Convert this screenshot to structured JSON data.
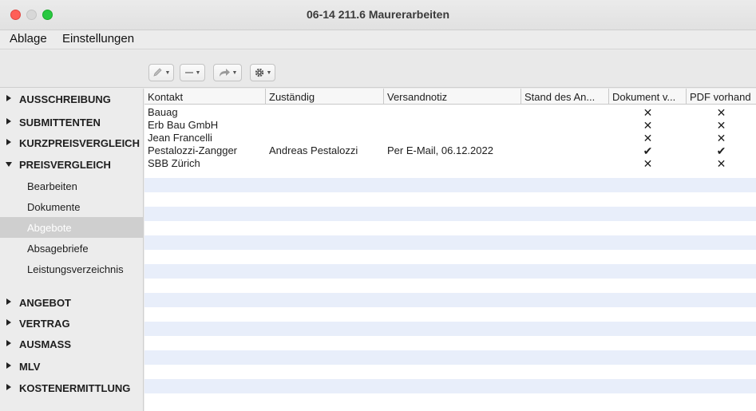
{
  "window": {
    "title": "06-14 211.6 Maurerarbeiten"
  },
  "menu": [
    "Ablage",
    "Einstellungen"
  ],
  "toolbar": {
    "buttons": [
      {
        "icon": "pencil-icon"
      },
      {
        "icon": "minus-icon"
      },
      {
        "icon": "share-arrow-icon"
      },
      {
        "icon": "gear-icon"
      }
    ]
  },
  "sidebar": {
    "sections": [
      {
        "label": "AUSSCHREIBUNG",
        "expanded": false
      },
      {
        "label": "SUBMITTENTEN",
        "expanded": false
      },
      {
        "label": "KURZPREISVERGLEICH",
        "expanded": false
      },
      {
        "label": "PREISVERGLEICH",
        "expanded": true,
        "items": [
          {
            "label": "Bearbeiten",
            "selected": false
          },
          {
            "label": "Dokumente",
            "selected": false
          },
          {
            "label": "Abgebote",
            "selected": true
          },
          {
            "label": "Absagebriefe",
            "selected": false
          },
          {
            "label": "Leistungsverzeichnis",
            "selected": false
          }
        ]
      },
      {
        "label": "ANGEBOT",
        "expanded": false
      },
      {
        "label": "VERTRAG",
        "expanded": false
      },
      {
        "label": "AUSMASS",
        "expanded": false
      },
      {
        "label": "MLV",
        "expanded": false
      },
      {
        "label": "KOSTENERMITTLUNG",
        "expanded": false
      }
    ]
  },
  "table": {
    "columns": [
      "Kontakt",
      "Zuständig",
      "Versandnotiz",
      "Stand des An...",
      "Dokument v...",
      "PDF vorhand"
    ],
    "rows": [
      [
        "Bauag",
        "",
        "",
        "",
        "✕",
        "✕"
      ],
      [
        "Erb Bau GmbH",
        "",
        "",
        "",
        "✕",
        "✕"
      ],
      [
        "Jean Francelli",
        "",
        "",
        "",
        "✕",
        "✕"
      ],
      [
        "Pestalozzi-Zangger",
        "Andreas Pestalozzi",
        "Per E-Mail, 06.12.2022",
        "",
        "✔",
        "✔"
      ],
      [
        "SBB Zürich",
        "",
        "",
        "",
        "✕",
        "✕"
      ]
    ]
  }
}
